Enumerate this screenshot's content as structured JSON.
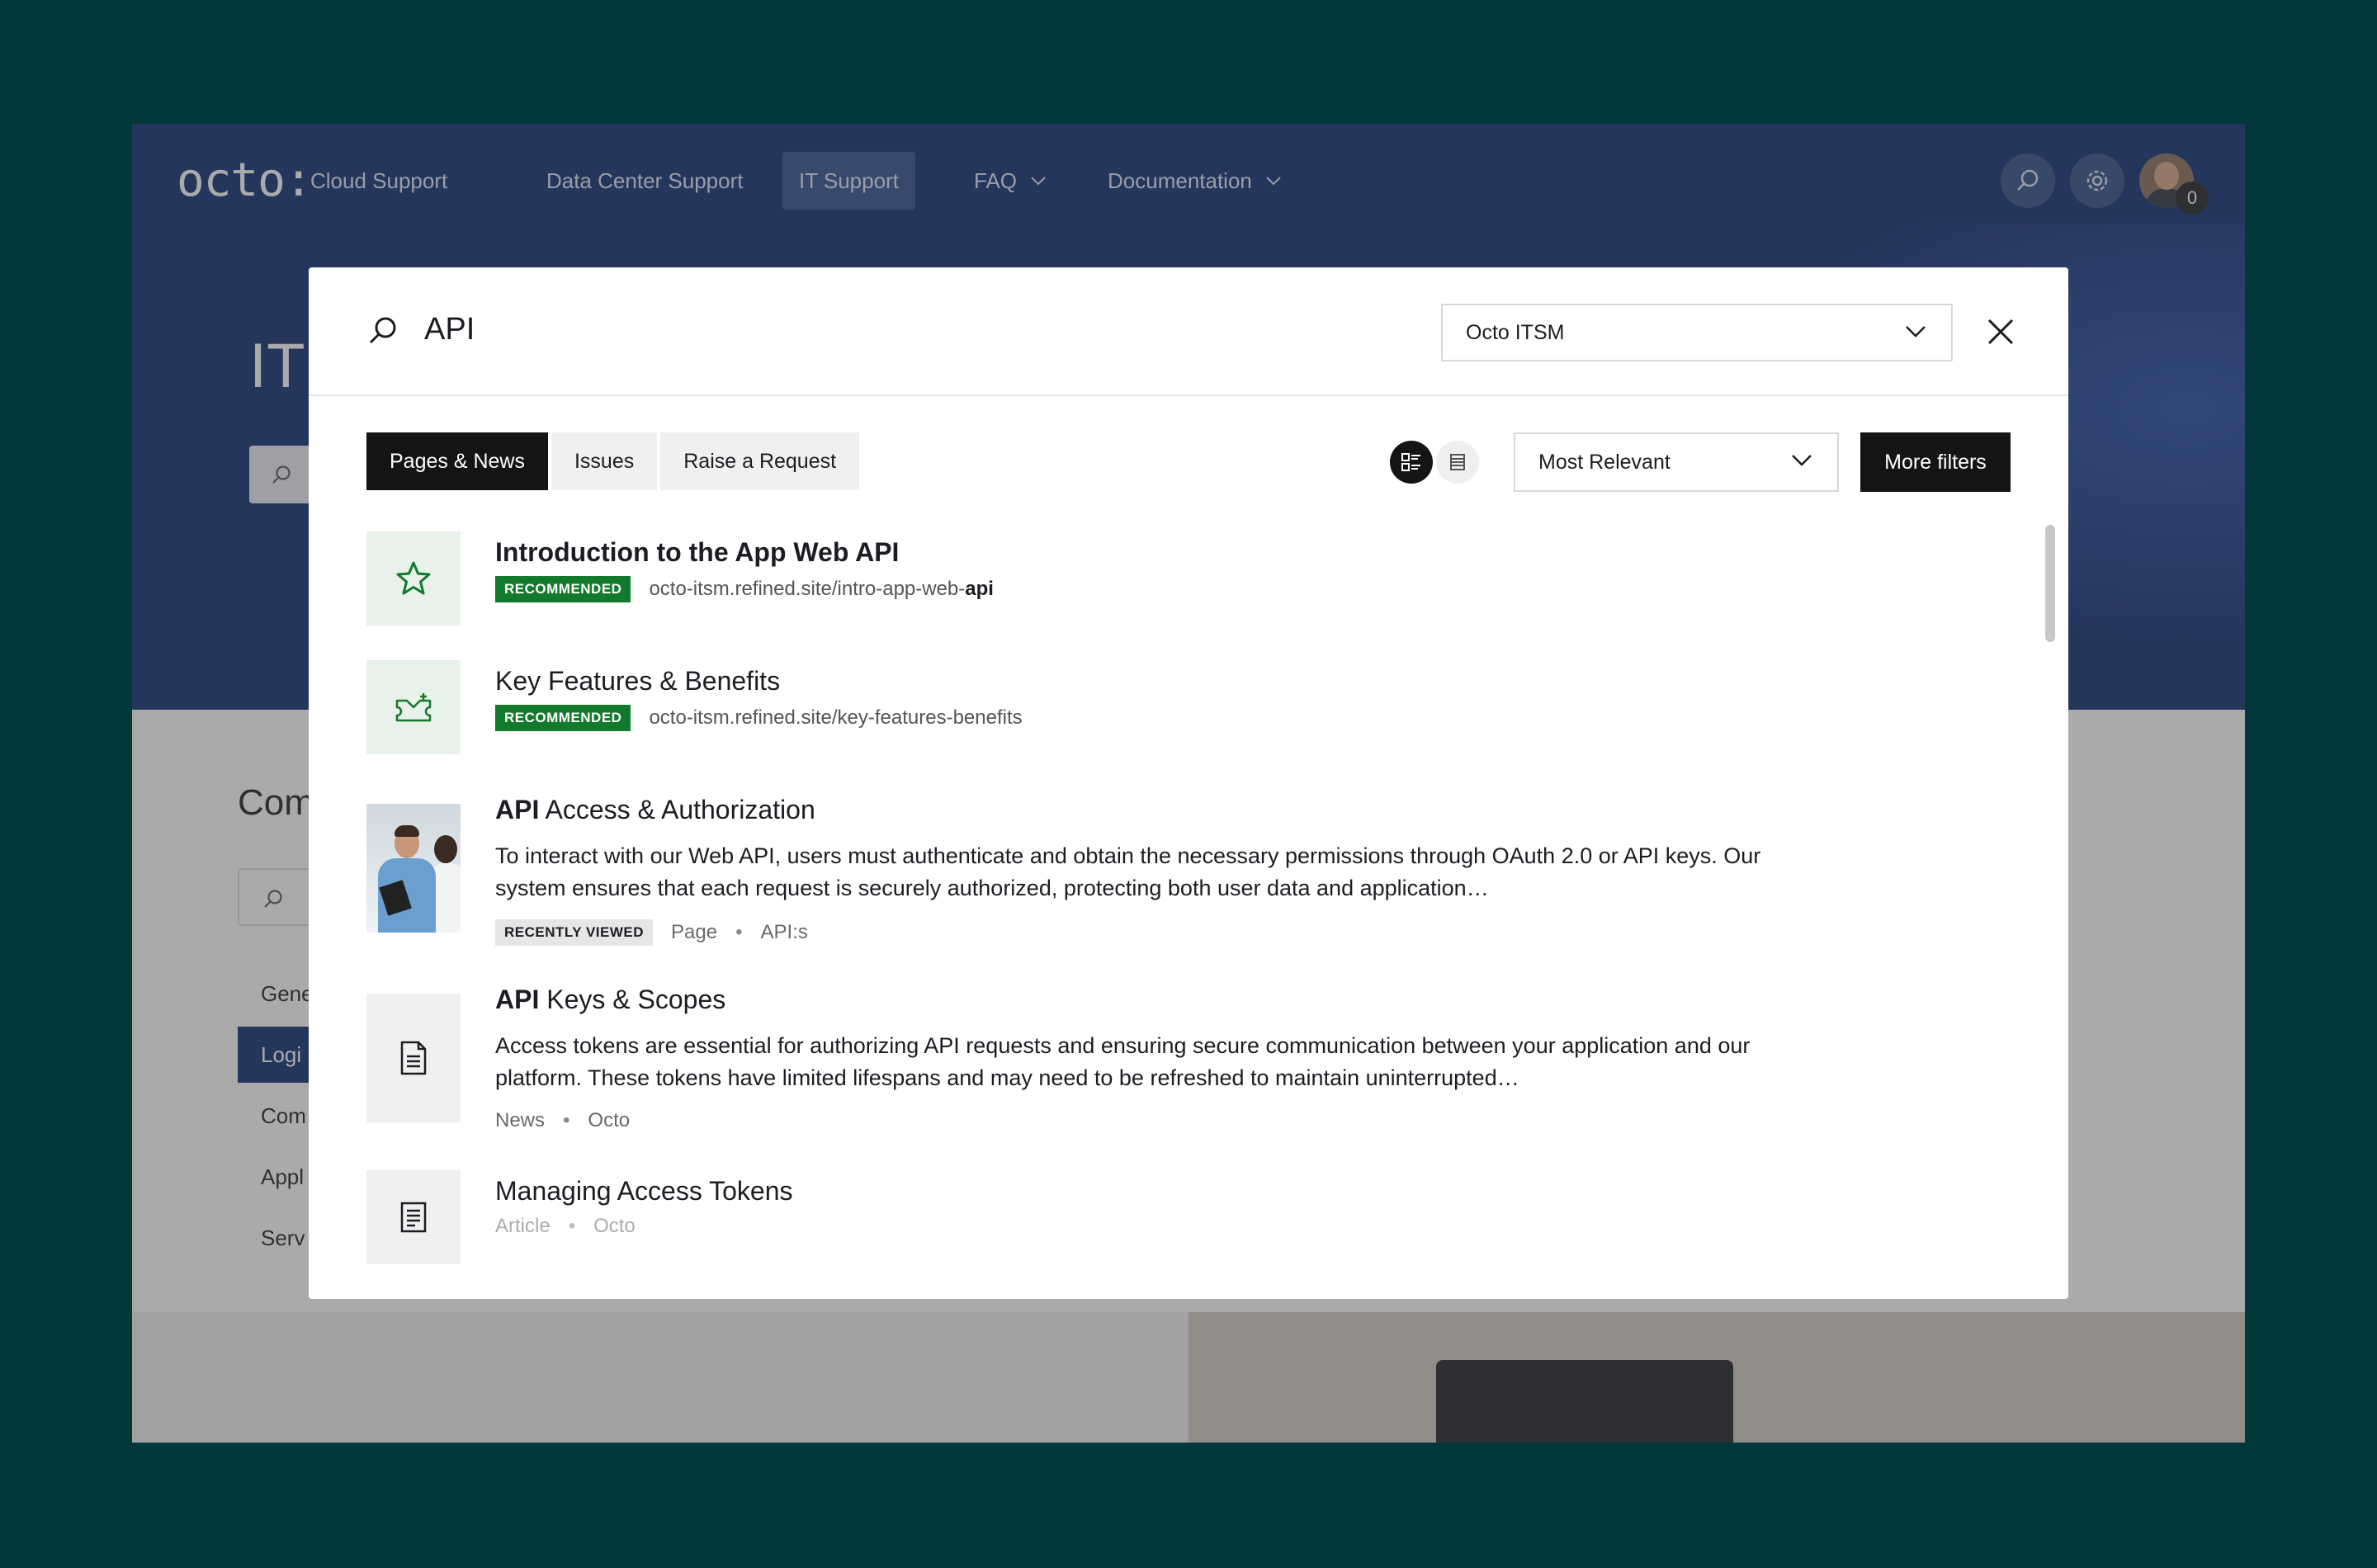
{
  "app": {
    "logo": "octo:",
    "nav": [
      {
        "label": "Cloud Support"
      },
      {
        "label": "Data Center Support"
      },
      {
        "label": "IT Support"
      },
      {
        "label": "FAQ"
      },
      {
        "label": "Documentation"
      }
    ],
    "notification_count": "0",
    "hero_title": "IT",
    "content_title": "Com",
    "sidebar": [
      {
        "label": "Gene"
      },
      {
        "label": "Logi"
      },
      {
        "label": "Com"
      },
      {
        "label": "Appl"
      },
      {
        "label": "Serv"
      }
    ]
  },
  "modal": {
    "query": "API",
    "space_select": "Octo ITSM",
    "tabs": [
      {
        "label": "Pages & News"
      },
      {
        "label": "Issues"
      },
      {
        "label": "Raise a Request"
      }
    ],
    "sort_select": "Most Relevant",
    "more_filters": "More filters",
    "results": [
      {
        "title": "Introduction to the App Web API",
        "badge": "RECOMMENDED",
        "url_prefix": "octo-itsm.refined.site/intro-app-web-",
        "url_highlight": "api"
      },
      {
        "title": "Key Features & Benefits",
        "badge": "RECOMMENDED",
        "url": "octo-itsm.refined.site/key-features-benefits"
      },
      {
        "title_highlight": "API",
        "title_rest": " Access & Authorization",
        "description": "To interact with our Web API, users must authenticate and obtain the necessary permissions through OAuth 2.0 or API keys. Our system ensures that each request is securely authorized, protecting both user data and application…",
        "badge": "RECENTLY VIEWED",
        "type": "Page",
        "space": "API:s"
      },
      {
        "title_highlight": "API",
        "title_rest": " Keys & Scopes",
        "description": "Access tokens are essential for authorizing API requests and ensuring secure communication between your application and our platform. These tokens have limited lifespans and may need to be refreshed to maintain uninterrupted…",
        "type": "News",
        "space": "Octo"
      },
      {
        "title": "Managing Access Tokens",
        "type": "Article",
        "space": "Octo"
      }
    ]
  },
  "colors": {
    "page_background": "#023839",
    "hero": "#0b2a72",
    "recommended_badge": "#117a2c",
    "primary_button": "#141416"
  },
  "icons": [
    "search-icon",
    "settings-icon",
    "chevron-down-icon",
    "close-icon",
    "star-icon",
    "ticket-icon",
    "document-icon",
    "article-icon",
    "list-detail-view-icon",
    "list-compact-view-icon"
  ]
}
